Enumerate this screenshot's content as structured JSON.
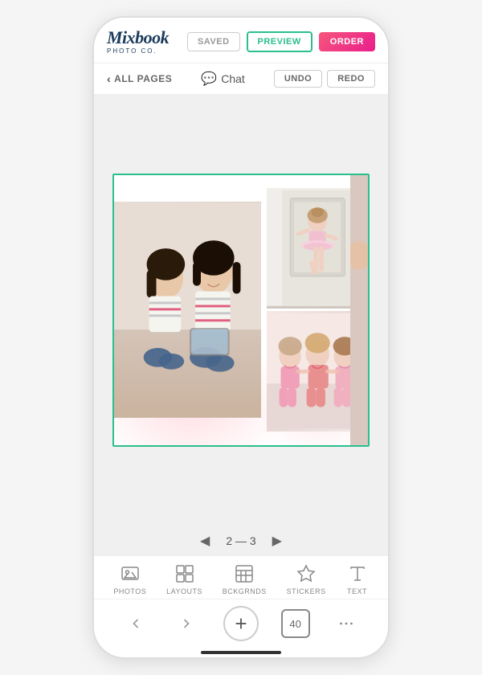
{
  "header": {
    "logo": "Mixbook",
    "logo_sub": "PHOTO CO.",
    "btn_saved": "SAVED",
    "btn_preview": "PREVIEW",
    "btn_order": "ORDER"
  },
  "toolbar": {
    "all_pages": "ALL PAGES",
    "chat": "Chat",
    "undo": "UNDO",
    "redo": "REDO"
  },
  "page_nav": {
    "page_indicator": "2 — 3",
    "left_arrow": "◀",
    "right_arrow": "▶"
  },
  "bottom_tools": [
    {
      "id": "photos",
      "label": "PHOTOS"
    },
    {
      "id": "layouts",
      "label": "LAYOUTS"
    },
    {
      "id": "bckgrnds",
      "label": "BCKGRNDS"
    },
    {
      "id": "stickers",
      "label": "STICKERS"
    },
    {
      "id": "text",
      "label": "TEXT"
    }
  ],
  "bottom_actions": {
    "back": "‹",
    "forward": "›",
    "add": "+",
    "count": "40",
    "more": "···"
  },
  "colors": {
    "green_accent": "#2bbf8e",
    "pink_accent": "#e91e8c",
    "dark_blue": "#1a3a5c"
  }
}
